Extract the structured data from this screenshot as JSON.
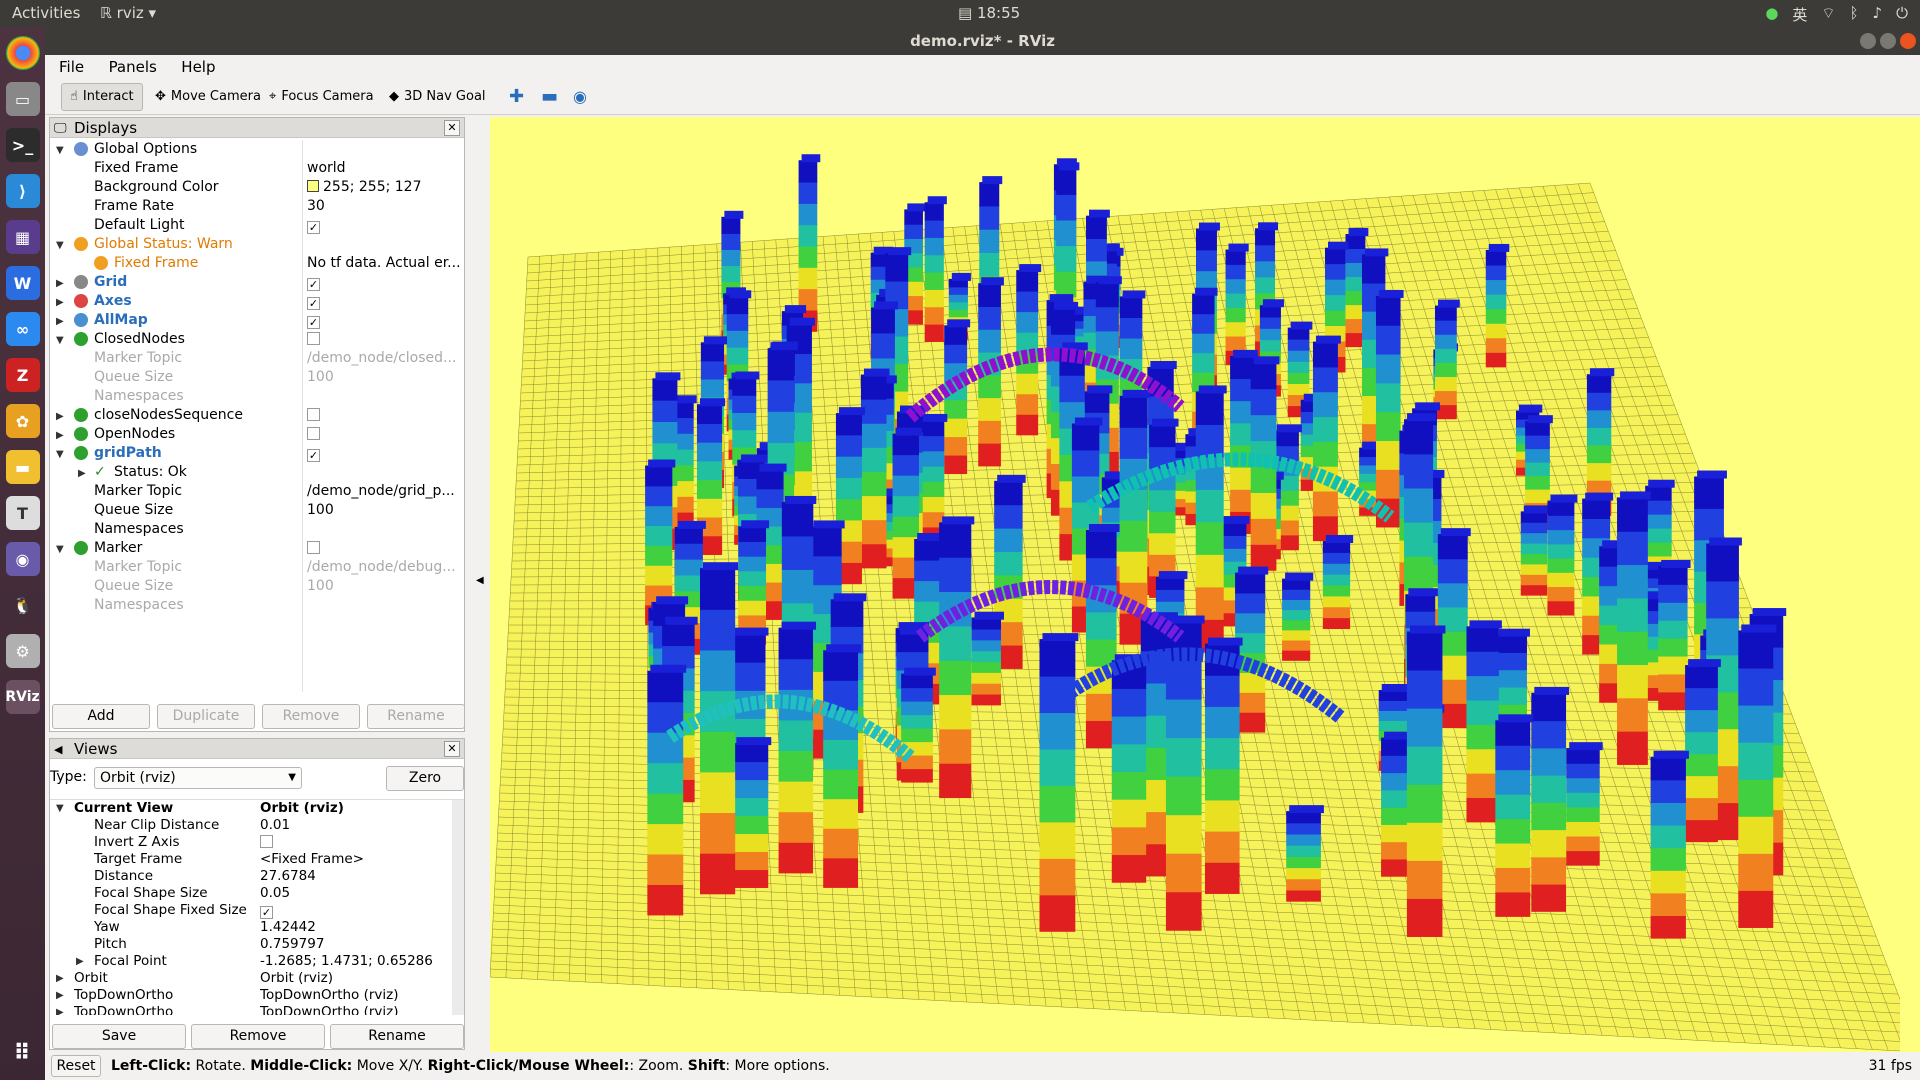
{
  "topbar": {
    "activities": "Activities",
    "app": "rviz",
    "clock": "18:55",
    "lang": "英"
  },
  "window": {
    "title": "demo.rviz* - RViz"
  },
  "menu": [
    "File",
    "Panels",
    "Help"
  ],
  "toolbar": {
    "interact": "Interact",
    "move_camera": "Move Camera",
    "focus_camera": "Focus Camera",
    "nav_goal": "3D Nav Goal"
  },
  "displays": {
    "title": "Displays",
    "rows": [
      {
        "label": "Global Options",
        "value": ""
      },
      {
        "label": "Fixed Frame",
        "value": "world"
      },
      {
        "label": "Background Color",
        "value": "255; 255; 127"
      },
      {
        "label": "Frame Rate",
        "value": "30"
      },
      {
        "label": "Default Light",
        "value": ""
      },
      {
        "label": "Global Status: Warn",
        "value": ""
      },
      {
        "label": "Fixed Frame",
        "value": "No tf data.  Actual er..."
      },
      {
        "label": "Grid",
        "value": ""
      },
      {
        "label": "Axes",
        "value": ""
      },
      {
        "label": "AllMap",
        "value": ""
      },
      {
        "label": "ClosedNodes",
        "value": ""
      },
      {
        "label": "Marker Topic",
        "value": "/demo_node/closed..."
      },
      {
        "label": "Queue Size",
        "value": "100"
      },
      {
        "label": "Namespaces",
        "value": ""
      },
      {
        "label": "closeNodesSequence",
        "value": ""
      },
      {
        "label": "OpenNodes",
        "value": ""
      },
      {
        "label": "gridPath",
        "value": ""
      },
      {
        "label": "Status: Ok",
        "value": ""
      },
      {
        "label": "Marker Topic",
        "value": "/demo_node/grid_p..."
      },
      {
        "label": "Queue Size",
        "value": "100"
      },
      {
        "label": "Namespaces",
        "value": ""
      },
      {
        "label": "Marker",
        "value": ""
      },
      {
        "label": "Marker Topic",
        "value": "/demo_node/debug..."
      },
      {
        "label": "Queue Size",
        "value": "100"
      },
      {
        "label": "Namespaces",
        "value": ""
      }
    ],
    "buttons": {
      "add": "Add",
      "duplicate": "Duplicate",
      "remove": "Remove",
      "rename": "Rename"
    }
  },
  "views": {
    "title": "Views",
    "type_label": "Type:",
    "type_value": "Orbit (rviz)",
    "zero": "Zero",
    "rows": [
      {
        "label": "Current View",
        "value": "Orbit (rviz)"
      },
      {
        "label": "Near Clip Distance",
        "value": "0.01"
      },
      {
        "label": "Invert Z Axis",
        "value": ""
      },
      {
        "label": "Target Frame",
        "value": "<Fixed Frame>"
      },
      {
        "label": "Distance",
        "value": "27.6784"
      },
      {
        "label": "Focal Shape Size",
        "value": "0.05"
      },
      {
        "label": "Focal Shape Fixed Size",
        "value": ""
      },
      {
        "label": "Yaw",
        "value": "1.42442"
      },
      {
        "label": "Pitch",
        "value": "0.759797"
      },
      {
        "label": "Focal Point",
        "value": "-1.2685; 1.4731; 0.65286"
      },
      {
        "label": "Orbit",
        "value": "Orbit (rviz)"
      },
      {
        "label": "TopDownOrtho",
        "value": "TopDownOrtho (rviz)"
      },
      {
        "label": "TopDownOrtho",
        "value": "TopDownOrtho (rviz)"
      }
    ],
    "buttons": {
      "save": "Save",
      "remove": "Remove",
      "rename": "Rename"
    }
  },
  "status": {
    "reset": "Reset",
    "hint_parts": [
      {
        "b": "Left-Click:",
        "t": " Rotate. "
      },
      {
        "b": "Middle-Click:",
        "t": " Move X/Y. "
      },
      {
        "b": "Right-Click/Mouse Wheel:",
        "t": ": Zoom. "
      },
      {
        "b": "Shift",
        "t": ": More options."
      }
    ],
    "fps": "31 fps"
  },
  "colors": {
    "viewport_bg": "#ffff7f",
    "grid": "#7a7a3a",
    "warn": "#e07b00",
    "link": "#2a6ebb"
  }
}
